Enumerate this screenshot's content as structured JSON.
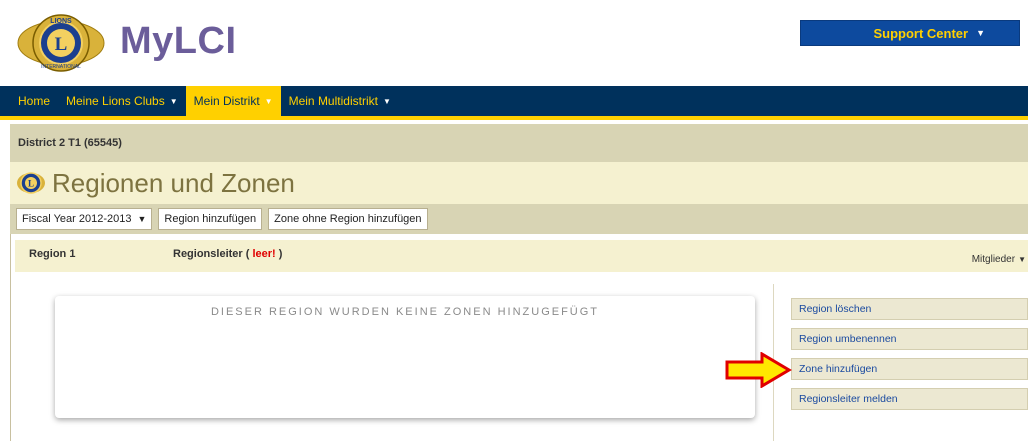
{
  "header": {
    "brand": "MyLCI",
    "support_label": "Support Center",
    "logo_icon": "lions-logo-icon"
  },
  "nav": {
    "items": [
      {
        "label": "Home",
        "has_caret": false,
        "active": false
      },
      {
        "label": "Meine Lions Clubs",
        "has_caret": true,
        "active": false
      },
      {
        "label": "Mein Distrikt",
        "has_caret": true,
        "active": true
      },
      {
        "label": "Mein Multidistrikt",
        "has_caret": true,
        "active": false
      }
    ]
  },
  "district": {
    "label": "District 2 T1 (65545)"
  },
  "page": {
    "title": "Regionen und Zonen"
  },
  "toolbar": {
    "fiscal_year": "Fiscal Year 2012-2013",
    "add_region": "Region hinzufügen",
    "add_zone_no_region": "Zone ohne Region hinzufügen"
  },
  "region": {
    "name": "Region 1",
    "leader_prefix": "Regionsleiter ( ",
    "leader_empty": "leer!",
    "leader_suffix": " )",
    "members_label": "Mitglieder",
    "empty_message": "DIESER REGION WURDEN KEINE ZONEN HINZUGEFÜGT"
  },
  "actions": {
    "delete_region": "Region löschen",
    "rename_region": "Region umbenennen",
    "add_zone": "Zone hinzufügen",
    "report_leader": "Regionsleiter melden"
  },
  "colors": {
    "nav_bg": "#00315c",
    "accent_yellow": "#ffd000",
    "brand_purple": "#6b5d9a",
    "support_blue": "#0d4a9e",
    "arrow_red": "#e00000"
  }
}
